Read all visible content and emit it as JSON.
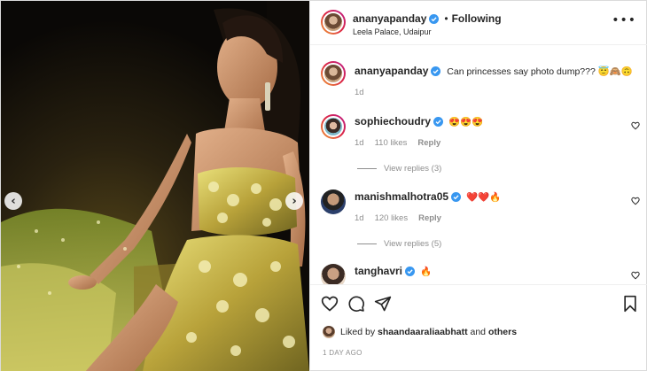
{
  "post": {
    "username": "ananyapanday",
    "following_label": "Following",
    "location": "Leela Palace, Udaipur",
    "more_label": "•••",
    "caption_user": "ananyapanday",
    "caption_text": "Can princesses say photo dump??? 😇🙈🙃",
    "caption_age": "1d"
  },
  "media": {
    "prev_label": "‹",
    "next_label": "›"
  },
  "comments": [
    {
      "user": "sophiechoudry",
      "text": "😍😍😍",
      "age": "1d",
      "likes": "110 likes",
      "reply": "Reply",
      "view_replies": "View replies (3)"
    },
    {
      "user": "manishmalhotra05",
      "text": "❤️❤️🔥",
      "age": "1d",
      "likes": "120 likes",
      "reply": "Reply",
      "view_replies": "View replies (5)"
    },
    {
      "user": "tanghavri",
      "text": "🔥"
    }
  ],
  "footer": {
    "liked_by_prefix": "Liked by",
    "liked_by_user": "shaandaaraliaabhatt",
    "and_label": "and",
    "others_label": "others",
    "posted_ago": "1 DAY AGO"
  },
  "icons": [
    "heart-icon",
    "comment-icon",
    "share-icon",
    "bookmark-icon",
    "verified-icon",
    "more-icon",
    "chevron-left-icon",
    "chevron-right-icon"
  ],
  "colors": {
    "verified": "#3897f0",
    "text": "#262626",
    "muted": "#8e8e8e",
    "border": "#dbdbdb"
  }
}
